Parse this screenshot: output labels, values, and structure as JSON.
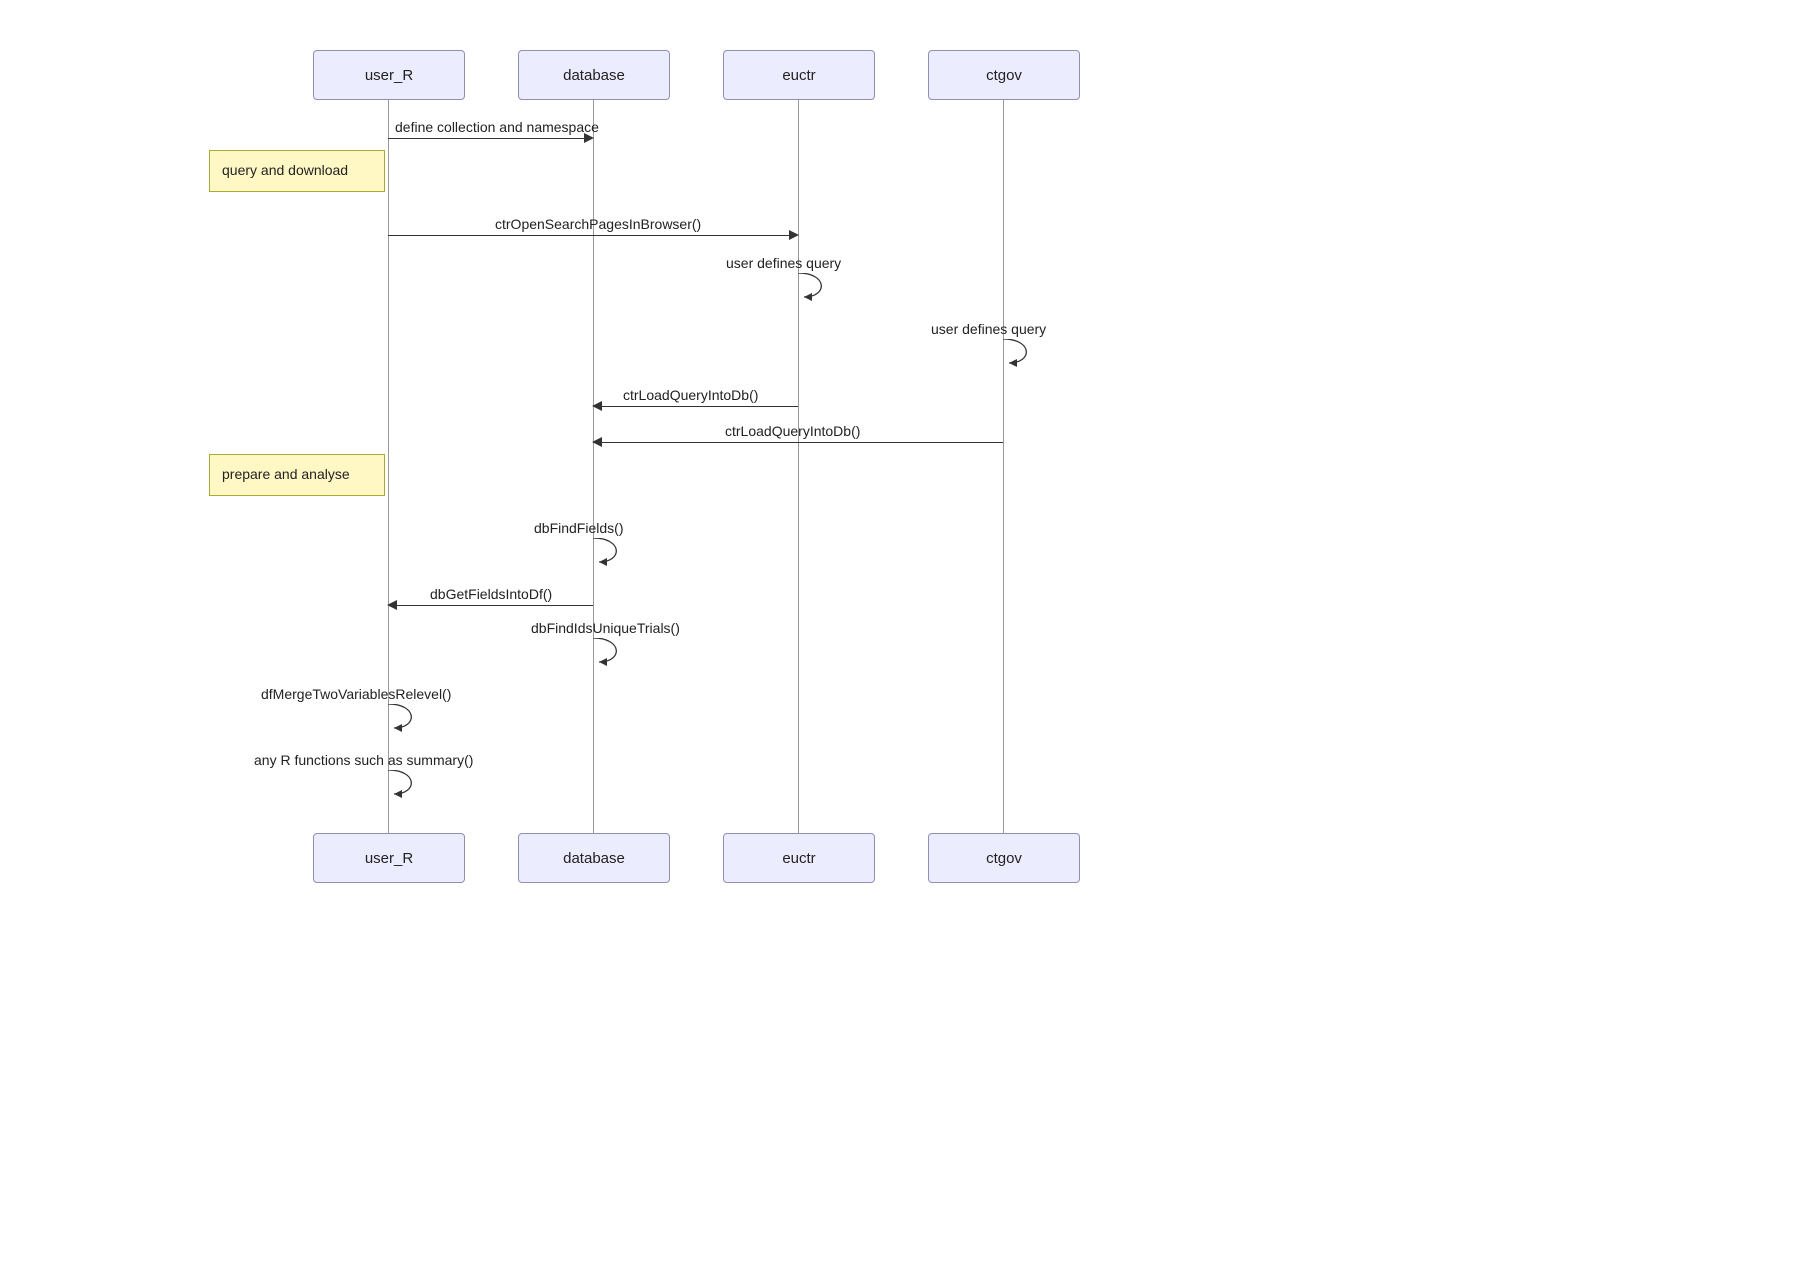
{
  "participants": {
    "user_R": "user_R",
    "database": "database",
    "euctr": "euctr",
    "ctgov": "ctgov"
  },
  "notes": {
    "query_download": "query and download",
    "prepare_analyse": "prepare and analyse"
  },
  "messages": {
    "m1": "define collection and namespace",
    "m2": "ctrOpenSearchPagesInBrowser()",
    "m3": "user defines query",
    "m4": "user defines query",
    "m5": "ctrLoadQueryIntoDb()",
    "m6": "ctrLoadQueryIntoDb()",
    "m7": "dbFindFields()",
    "m8": "dbGetFieldsIntoDf()",
    "m9": "dbFindIdsUniqueTrials()",
    "m10": "dfMergeTwoVariablesRelevel()",
    "m11": "any R functions such as summary()"
  }
}
